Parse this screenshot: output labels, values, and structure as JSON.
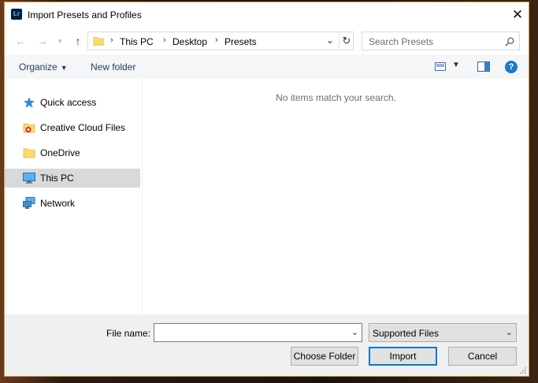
{
  "window": {
    "title": "Import Presets and Profiles",
    "app_icon_text": "Lr"
  },
  "address_bar": {
    "breadcrumbs": [
      "This PC",
      "Desktop",
      "Presets"
    ]
  },
  "search": {
    "placeholder": "Search Presets"
  },
  "toolbar": {
    "organize_label": "Organize",
    "new_folder_label": "New folder"
  },
  "nav_pane": {
    "items": [
      {
        "label": "Quick access",
        "icon": "star-icon"
      },
      {
        "label": "Creative Cloud Files",
        "icon": "creative-cloud-folder-icon"
      },
      {
        "label": "OneDrive",
        "icon": "folder-icon"
      },
      {
        "label": "This PC",
        "icon": "computer-icon",
        "selected": true
      },
      {
        "label": "Network",
        "icon": "network-icon"
      }
    ]
  },
  "content": {
    "empty_message": "No items match your search."
  },
  "footer": {
    "file_name_label": "File name:",
    "file_name_value": "",
    "filter_value": "Supported Files",
    "choose_folder_label": "Choose Folder",
    "import_label": "Import",
    "cancel_label": "Cancel"
  },
  "colors": {
    "accent": "#0078d7",
    "help": "#1979ca",
    "selection": "#d9d9d9",
    "folder": "#ffd86a"
  }
}
